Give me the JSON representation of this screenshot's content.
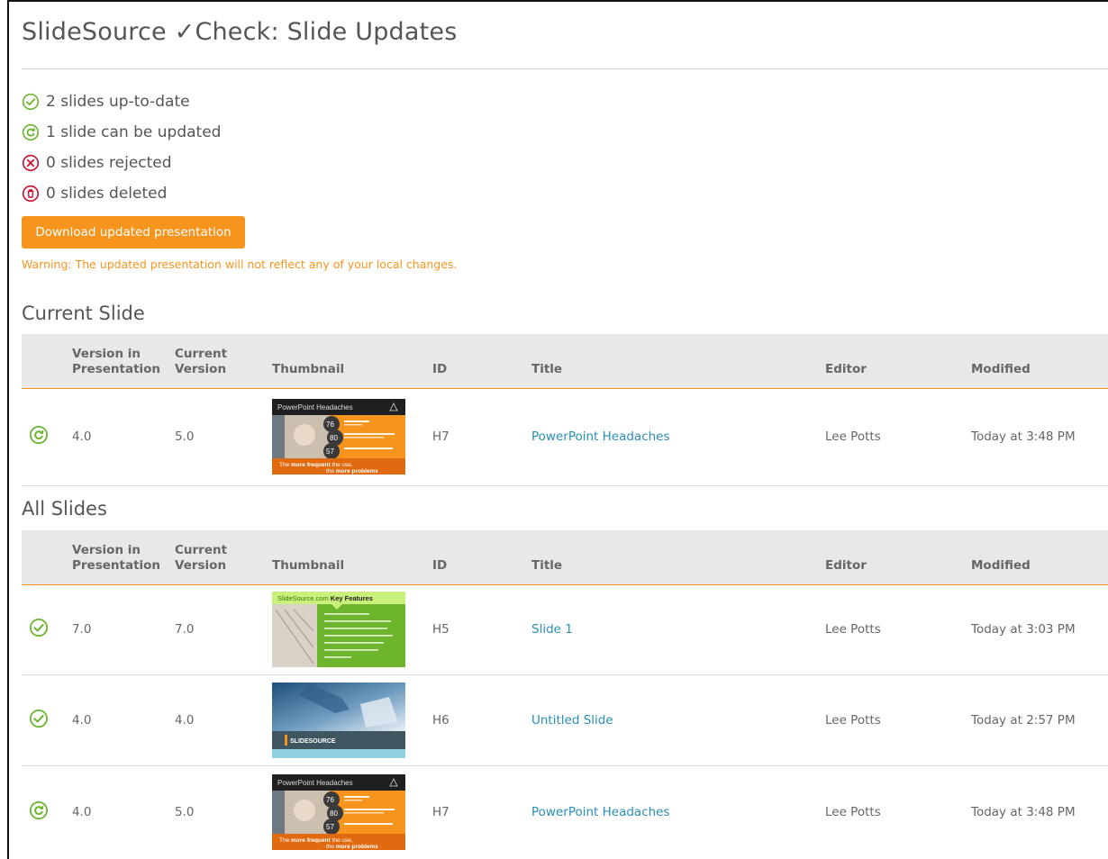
{
  "page": {
    "title_prefix": "SlideSource ",
    "title_mark": "✓",
    "title_suffix": "Check: Slide Updates"
  },
  "summary": [
    {
      "icon": "check-circle-icon",
      "text": "2 slides up-to-date"
    },
    {
      "icon": "refresh-circle-icon",
      "text": "1 slide can be updated"
    },
    {
      "icon": "x-circle-icon",
      "text": "0 slides rejected"
    },
    {
      "icon": "trash-circle-icon",
      "text": "0 slides deleted"
    }
  ],
  "actions": {
    "download_label": "Download updated presentation",
    "warning": "Warning: The updated presentation will not reflect any of your local changes."
  },
  "table_headers": {
    "version_in_presentation": [
      "Version in",
      "Presentation"
    ],
    "current_version": [
      "Current",
      "Version"
    ],
    "thumbnail": "Thumbnail",
    "id": "ID",
    "title": "Title",
    "editor": "Editor",
    "modified": "Modified"
  },
  "current_slide": {
    "heading": "Current Slide",
    "rows": [
      {
        "status": "refresh",
        "version_in_presentation": "4.0",
        "current_version": "5.0",
        "thumbnail": "powerpoint-headaches",
        "id": "H7",
        "title": "PowerPoint Headaches",
        "editor": "Lee Potts",
        "modified": "Today at 3:48 PM"
      }
    ]
  },
  "all_slides": {
    "heading": "All Slides",
    "rows": [
      {
        "status": "check",
        "version_in_presentation": "7.0",
        "current_version": "7.0",
        "thumbnail": "key-features",
        "id": "H5",
        "title": "Slide 1",
        "editor": "Lee Potts",
        "modified": "Today at 3:03 PM"
      },
      {
        "status": "check",
        "version_in_presentation": "4.0",
        "current_version": "4.0",
        "thumbnail": "untitled",
        "id": "H6",
        "title": "Untitled Slide",
        "editor": "Lee Potts",
        "modified": "Today at 2:57 PM"
      },
      {
        "status": "refresh",
        "version_in_presentation": "4.0",
        "current_version": "5.0",
        "thumbnail": "powerpoint-headaches",
        "id": "H7",
        "title": "PowerPoint Headaches",
        "editor": "Lee Potts",
        "modified": "Today at 3:48 PM"
      }
    ]
  },
  "thumbnails": {
    "powerpoint-headaches": {
      "heading": "PowerPoint Headaches",
      "stats": [
        "76",
        "80",
        "57"
      ],
      "footer_a": "The ",
      "footer_b": "more frequent",
      "footer_c": " the use,",
      "footer_d": "the ",
      "footer_e": "more problems"
    },
    "key-features": {
      "heading_a": "SlideSource.com ",
      "heading_b": "Key Features"
    },
    "untitled": {
      "logo": "SLIDESOURCE"
    }
  },
  "colors": {
    "accent_orange": "#f7941d",
    "status_green": "#6ab42d",
    "status_red": "#c8102e",
    "link_blue": "#2a8fb5"
  }
}
